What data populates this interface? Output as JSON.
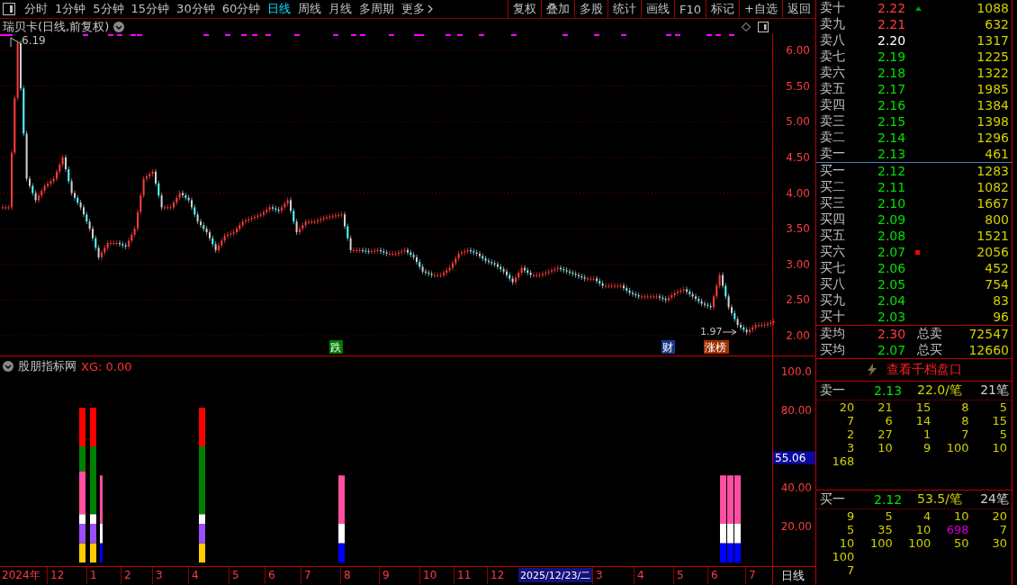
{
  "toolbar": {
    "periods": [
      {
        "label": "分时",
        "selected": false
      },
      {
        "label": "1分钟",
        "selected": false
      },
      {
        "label": "5分钟",
        "selected": false
      },
      {
        "label": "15分钟",
        "selected": false
      },
      {
        "label": "30分钟",
        "selected": false
      },
      {
        "label": "60分钟",
        "selected": false
      },
      {
        "label": "日线",
        "selected": true
      },
      {
        "label": "周线",
        "selected": false
      },
      {
        "label": "月线",
        "selected": false
      },
      {
        "label": "多周期",
        "selected": false
      },
      {
        "label": "更多",
        "selected": false
      }
    ],
    "actions": [
      "复权",
      "叠加",
      "多股",
      "统计",
      "画线",
      "F10",
      "标记",
      "+自选",
      "返回"
    ]
  },
  "chart_title": "瑞贝卡(日线,前复权)",
  "price_chart": {
    "high_label": "6.19",
    "low_label": "1.97",
    "events": [
      {
        "label": "跌",
        "kind": "drop"
      },
      {
        "label": "财",
        "kind": "finance"
      },
      {
        "label": "涨榜",
        "kind": "limit-up"
      }
    ],
    "axis_labels": [
      "6.00",
      "5.50",
      "5.00",
      "4.50",
      "4.00",
      "3.50",
      "3.00",
      "2.50",
      "2.00"
    ]
  },
  "indicator": {
    "name": "股朋指标网",
    "reading": "XG: 0.00",
    "current_value": "55.06",
    "axis_labels": [
      "100.0",
      "80.00",
      "40.00",
      "20.00"
    ]
  },
  "time_axis": {
    "labels": [
      "2024年",
      "12",
      "1",
      "2",
      "3",
      "4",
      "5",
      "6",
      "7",
      "8",
      "9",
      "10",
      "11",
      "12",
      "3",
      "4",
      "5",
      "6",
      "7"
    ],
    "cursor_date": "2025/12/23/二",
    "period": "日线"
  },
  "order_book": {
    "asks": [
      {
        "label": "卖十",
        "price": "2.22",
        "color": "#ff3c3c",
        "volume": "1088",
        "kind": "triangle"
      },
      {
        "label": "卖九",
        "price": "2.21",
        "color": "#ff3c3c",
        "volume": "632",
        "kind": "plain"
      },
      {
        "label": "卖八",
        "price": "2.20",
        "color": "#ffffff",
        "volume": "1317",
        "kind": "plain"
      },
      {
        "label": "卖七",
        "price": "2.19",
        "color": "#00e000",
        "volume": "1225",
        "kind": "plain"
      },
      {
        "label": "卖六",
        "price": "2.18",
        "color": "#00e000",
        "volume": "1322",
        "kind": "plain"
      },
      {
        "label": "卖五",
        "price": "2.17",
        "color": "#00e000",
        "volume": "1985",
        "kind": "plain"
      },
      {
        "label": "卖四",
        "price": "2.16",
        "color": "#00e000",
        "volume": "1384",
        "kind": "plain"
      },
      {
        "label": "卖三",
        "price": "2.15",
        "color": "#00e000",
        "volume": "1398",
        "kind": "plain"
      },
      {
        "label": "卖二",
        "price": "2.14",
        "color": "#00e000",
        "volume": "1296",
        "kind": "plain"
      },
      {
        "label": "卖一",
        "price": "2.13",
        "color": "#00e000",
        "volume": "461",
        "kind": "plain"
      }
    ],
    "bids": [
      {
        "label": "买一",
        "price": "2.12",
        "color": "#00e000",
        "volume": "1283",
        "kind": "plain"
      },
      {
        "label": "买二",
        "price": "2.11",
        "color": "#00e000",
        "volume": "1082",
        "kind": "plain"
      },
      {
        "label": "买三",
        "price": "2.10",
        "color": "#00e000",
        "volume": "1667",
        "kind": "plain"
      },
      {
        "label": "买四",
        "price": "2.09",
        "color": "#00e000",
        "volume": "800",
        "kind": "plain"
      },
      {
        "label": "买五",
        "price": "2.08",
        "color": "#00e000",
        "volume": "1521",
        "kind": "plain"
      },
      {
        "label": "买六",
        "price": "2.07",
        "color": "#00e000",
        "volume": "2056",
        "kind": "square"
      },
      {
        "label": "买七",
        "price": "2.06",
        "color": "#00e000",
        "volume": "452",
        "kind": "plain"
      },
      {
        "label": "买八",
        "price": "2.05",
        "color": "#00e000",
        "volume": "754",
        "kind": "plain"
      },
      {
        "label": "买九",
        "price": "2.04",
        "color": "#00e000",
        "volume": "83",
        "kind": "plain"
      },
      {
        "label": "买十",
        "price": "2.03",
        "color": "#00e000",
        "volume": "96",
        "kind": "plain"
      }
    ],
    "summary": [
      {
        "label": "卖均",
        "price": "2.30",
        "color": "#ff3c3c",
        "total_label": "总卖",
        "total": "72547"
      },
      {
        "label": "买均",
        "price": "2.07",
        "color": "#00e000",
        "total_label": "总买",
        "total": "12660"
      }
    ]
  },
  "depth_link": "查看千档盘口",
  "queues": [
    {
      "label": "卖一",
      "price": "2.13",
      "average": "22.0/笔",
      "count": "21笔",
      "orders": [
        [
          "20",
          "21",
          "15",
          "8",
          "5"
        ],
        [
          "7",
          "6",
          "14",
          "8",
          "15"
        ],
        [
          "2",
          "27",
          "1",
          "7",
          "5"
        ],
        [
          "3",
          "10",
          "9",
          "100",
          "10"
        ],
        [
          "168"
        ]
      ]
    },
    {
      "label": "买一",
      "price": "2.12",
      "average": "53.5/笔",
      "count": "24笔",
      "orders": [
        [
          "9",
          "5",
          "4",
          "10",
          "20"
        ],
        [
          "5",
          "35",
          "10",
          {
            "value": "698",
            "large": true
          },
          "7"
        ],
        [
          "10",
          "100",
          "100",
          "50",
          "30"
        ],
        [
          "100"
        ],
        [
          "7"
        ]
      ]
    }
  ]
}
